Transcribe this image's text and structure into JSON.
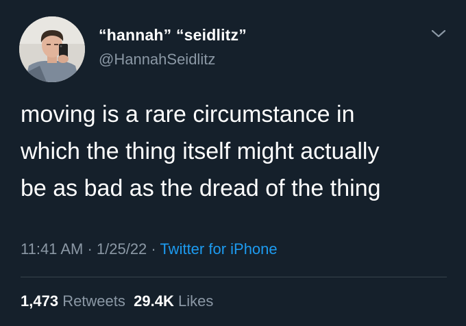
{
  "author": {
    "display_name": "“hannah” “seidlitz”",
    "handle": "@HannahSeidlitz"
  },
  "tweet": {
    "lines": [
      "moving is a rare circumstance in",
      "which the thing itself might actually",
      "be as bad as the dread of the thing"
    ]
  },
  "meta": {
    "time": "11:41 AM",
    "separator": " · ",
    "date": "1/25/22",
    "source": "Twitter for iPhone"
  },
  "stats": {
    "retweets_count": "1,473",
    "retweets_label": "Retweets",
    "likes_count": "29.4K",
    "likes_label": "Likes"
  },
  "icons": {
    "menu": "chevron-down-icon",
    "avatar": "profile-photo"
  },
  "colors": {
    "background": "#15202b",
    "primary_text": "#ffffff",
    "secondary_text": "#8b98a5",
    "link": "#1d9bf0",
    "divider": "#38444d"
  }
}
